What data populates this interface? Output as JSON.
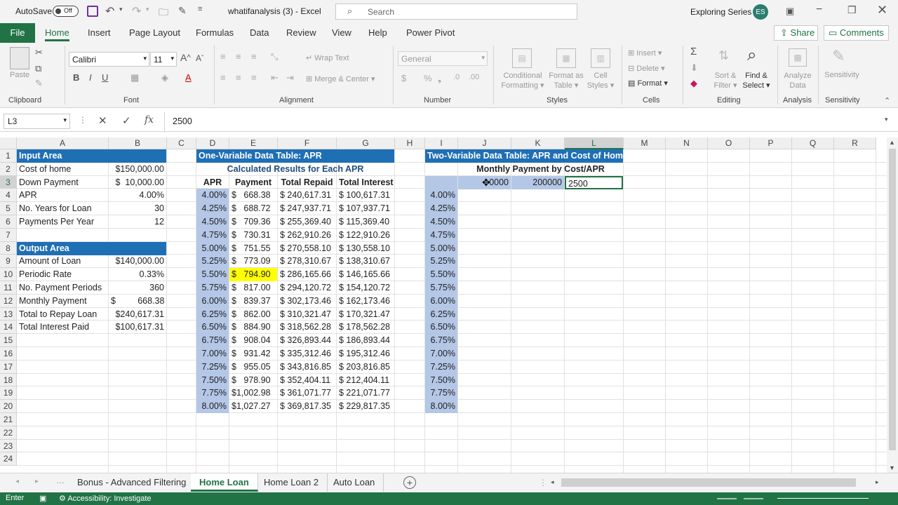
{
  "titlebar": {
    "autosave": "AutoSave",
    "autosave_state": "Off",
    "filename": "whatifanalysis (3)",
    "app": "Excel",
    "search_placeholder": "Search",
    "user": "Exploring Series",
    "initials": "ES"
  },
  "tabs": [
    "File",
    "Home",
    "Insert",
    "Page Layout",
    "Formulas",
    "Data",
    "Review",
    "View",
    "Help",
    "Power Pivot"
  ],
  "share": "Share",
  "comments": "Comments",
  "ribbon": {
    "paste": "Paste",
    "clipboard": "Clipboard",
    "font_name": "Calibri",
    "font_size": "11",
    "font": "Font",
    "wrap_text": "Wrap Text",
    "merge_center": "Merge & Center",
    "alignment": "Alignment",
    "number_format": "General",
    "number": "Number",
    "conditional": "Conditional",
    "formatting": "Formatting",
    "format_as": "Format as",
    "table": "Table",
    "cell": "Cell",
    "styles_btn": "Styles",
    "styles": "Styles",
    "insert": "Insert",
    "delete": "Delete",
    "format": "Format",
    "cells": "Cells",
    "sort": "Sort &",
    "filter": "Filter",
    "find": "Find &",
    "select": "Select",
    "editing": "Editing",
    "analyze": "Analyze",
    "data": "Data",
    "analysis": "Analysis",
    "sensitivity": "Sensitivity",
    "sensitivity_grp": "Sensitivity"
  },
  "formula_bar": {
    "name_box": "L3",
    "value": "2500"
  },
  "columns": [
    "A",
    "B",
    "C",
    "D",
    "E",
    "F",
    "G",
    "H",
    "I",
    "J",
    "K",
    "L",
    "M",
    "N",
    "O",
    "P",
    "Q",
    "R"
  ],
  "rows": [
    "1",
    "2",
    "3",
    "4",
    "5",
    "6",
    "7",
    "8",
    "9",
    "10",
    "11",
    "12",
    "13",
    "14",
    "15",
    "16",
    "17",
    "18",
    "19",
    "20",
    "21",
    "22",
    "23",
    "24"
  ],
  "input": {
    "header": "Input Area",
    "labels": [
      "Cost of home",
      "Down Payment",
      "APR",
      "No. Years for Loan",
      "Payments Per Year"
    ],
    "values": [
      "$150,000.00",
      "$  10,000.00",
      "4.00%",
      "30",
      "12"
    ]
  },
  "output": {
    "header": "Output Area",
    "labels": [
      "Amount of Loan",
      "Periodic Rate",
      "No. Payment Periods",
      "Monthly Payment",
      "Total to Repay Loan",
      "Total Interest Paid"
    ],
    "values": [
      "$140,000.00",
      "0.33%",
      "360",
      "$         668.38",
      "$240,617.31",
      "$100,617.31"
    ]
  },
  "onevar": {
    "title": "One-Variable Data Table: APR",
    "subtitle": "Calculated Results for Each APR",
    "headers": [
      "APR",
      "Payment",
      "Total Repaid",
      "Total Interest"
    ],
    "rows": [
      [
        "4.00%",
        "$   668.38",
        "$ 240,617.31",
        "$ 100,617.31"
      ],
      [
        "4.25%",
        "$   688.72",
        "$ 247,937.71",
        "$ 107,937.71"
      ],
      [
        "4.50%",
        "$   709.36",
        "$ 255,369.40",
        "$ 115,369.40"
      ],
      [
        "4.75%",
        "$   730.31",
        "$ 262,910.26",
        "$ 122,910.26"
      ],
      [
        "5.00%",
        "$   751.55",
        "$ 270,558.10",
        "$ 130,558.10"
      ],
      [
        "5.25%",
        "$   773.09",
        "$ 278,310.67",
        "$ 138,310.67"
      ],
      [
        "5.50%",
        "$   794.90",
        "$ 286,165.66",
        "$ 146,165.66"
      ],
      [
        "5.75%",
        "$   817.00",
        "$ 294,120.72",
        "$ 154,120.72"
      ],
      [
        "6.00%",
        "$   839.37",
        "$ 302,173.46",
        "$ 162,173.46"
      ],
      [
        "6.25%",
        "$   862.00",
        "$ 310,321.47",
        "$ 170,321.47"
      ],
      [
        "6.50%",
        "$   884.90",
        "$ 318,562.28",
        "$ 178,562.28"
      ],
      [
        "6.75%",
        "$   908.04",
        "$ 326,893.44",
        "$ 186,893.44"
      ],
      [
        "7.00%",
        "$   931.42",
        "$ 335,312.46",
        "$ 195,312.46"
      ],
      [
        "7.25%",
        "$   955.05",
        "$ 343,816.85",
        "$ 203,816.85"
      ],
      [
        "7.50%",
        "$   978.90",
        "$ 352,404.11",
        "$ 212,404.11"
      ],
      [
        "7.75%",
        "$1,002.98",
        "$ 361,071.77",
        "$ 221,071.77"
      ],
      [
        "8.00%",
        "$1,027.27",
        "$ 369,817.35",
        "$ 229,817.35"
      ]
    ]
  },
  "twovar": {
    "title": "Two-Variable Data Table: APR and Cost of Home",
    "subtitle": "Monthly Payment by Cost/APR",
    "j3": "0000",
    "k3": "200000",
    "l3": "2500",
    "aprs": [
      "4.00%",
      "4.25%",
      "4.50%",
      "4.75%",
      "5.00%",
      "5.25%",
      "5.50%",
      "5.75%",
      "6.00%",
      "6.25%",
      "6.50%",
      "6.75%",
      "7.00%",
      "7.25%",
      "7.50%",
      "7.75%",
      "8.00%"
    ]
  },
  "sheets": [
    "Bonus - Advanced Filtering",
    "Home Loan",
    "Home Loan 2",
    "Auto Loan"
  ],
  "status": {
    "mode": "Enter",
    "accessibility": "Accessibility: Investigate"
  }
}
